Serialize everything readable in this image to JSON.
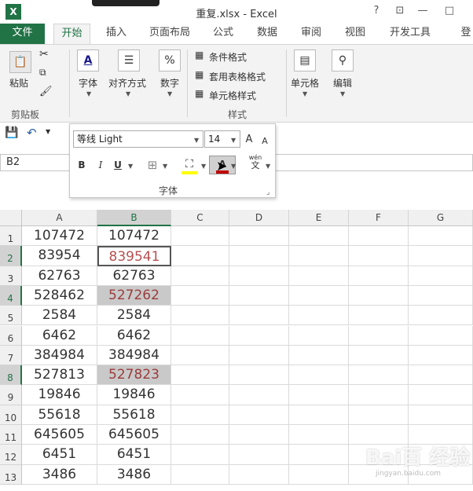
{
  "titlebar": {
    "app_icon": "X",
    "title": "重复.xlsx - Excel",
    "help": "?",
    "restore": "⊡",
    "minimize": "—",
    "maximize": "□"
  },
  "tabs": {
    "file": "文件",
    "home": "开始",
    "insert": "插入",
    "layout": "页面布局",
    "formulas": "公式",
    "data": "数据",
    "review": "审阅",
    "view": "视图",
    "developer": "开发工具",
    "login": "登"
  },
  "ribbon": {
    "paste": "粘贴",
    "clipboard": "剪贴板",
    "font_btn": "字体",
    "align_btn": "对齐方式",
    "number_btn": "数字",
    "cond_format": "条件格式",
    "table_format": "套用表格格式",
    "cell_style": "单元格样式",
    "styles_group": "样式",
    "cells_btn": "单元格",
    "edit_btn": "编辑"
  },
  "popup": {
    "font_name": "等线 Light",
    "font_size": "14",
    "bold": "B",
    "italic": "I",
    "underline": "U",
    "font_color_glyph": "A",
    "phonetic_glyph": "wén",
    "phonetic_glyph2": "文",
    "group_label": "字体",
    "grow": "A",
    "shrink": "A",
    "percent": "%"
  },
  "namebox": "B2",
  "columns": [
    "A",
    "B",
    "C",
    "D",
    "E",
    "F",
    "G"
  ],
  "rows": [
    {
      "n": "1",
      "a": "107472",
      "b": "107472"
    },
    {
      "n": "2",
      "a": "83954",
      "b": "839541"
    },
    {
      "n": "3",
      "a": "62763",
      "b": "62763"
    },
    {
      "n": "4",
      "a": "528462",
      "b": "527262"
    },
    {
      "n": "5",
      "a": "2584",
      "b": "2584"
    },
    {
      "n": "6",
      "a": "6462",
      "b": "6462"
    },
    {
      "n": "7",
      "a": "384984",
      "b": "384984"
    },
    {
      "n": "8",
      "a": "527813",
      "b": "527823"
    },
    {
      "n": "9",
      "a": "19846",
      "b": "19846"
    },
    {
      "n": "10",
      "a": "55618",
      "b": "55618"
    },
    {
      "n": "11",
      "a": "645605",
      "b": "645605"
    },
    {
      "n": "12",
      "a": "6451",
      "b": "6451"
    },
    {
      "n": "13",
      "a": "3486",
      "b": "3486"
    }
  ],
  "watermark": {
    "logo": "Bai百 经验",
    "url": "jingyan.baidu.com"
  },
  "colors": {
    "accent": "#217346",
    "dup_text": "#9c3c3c",
    "dup_fill": "#c9c9c9"
  }
}
